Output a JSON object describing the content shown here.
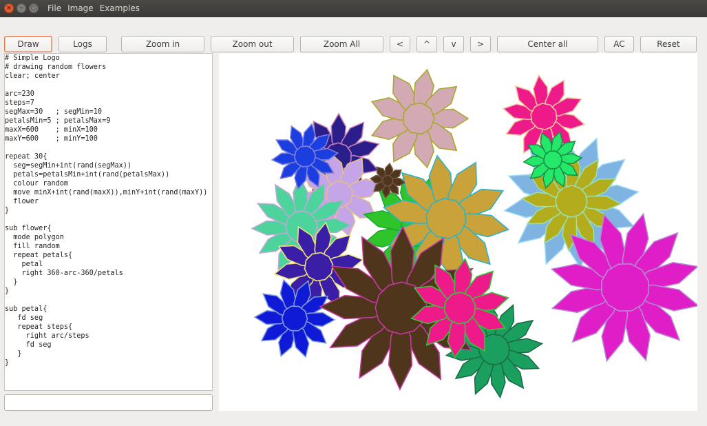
{
  "window": {
    "controls": {
      "close": "×",
      "minimize": "–",
      "maximize": "□"
    }
  },
  "menu": [
    "File",
    "Image",
    "Examples"
  ],
  "toolbar": {
    "draw": "Draw",
    "logs": "Logs",
    "zoom_in": "Zoom in",
    "zoom_out": "Zoom out",
    "zoom_all": "Zoom All",
    "left": "<",
    "up": "^",
    "down": "v",
    "right": ">",
    "center_all": "Center all",
    "ac": "AC",
    "reset": "Reset"
  },
  "editor": {
    "code": "# Simple Logo\n# drawing random flowers\nclear; center\n\narc=230\nsteps=7\nsegMax=30   ; segMin=10\npetalsMin=5 ; petalsMax=9\nmaxX=600    ; minX=100\nmaxY=600    ; minY=100\n\nrepeat 30{\n  seg=segMin+int(rand(segMax))\n  petals=petalsMin+int(rand(petalsMax))\n  colour random\n  move minX+int(rand(maxX)),minY+int(rand(maxY))\n  flower\n}\n\nsub flower{\n  mode polygon\n  fill random\n  repeat petals{\n    petal\n    right 360-arc-360/petals\n  }\n}\n\nsub petal{\n   fd seg\n   repeat steps{\n     right arc/steps\n     fd seg\n   }\n}"
  },
  "command_input": {
    "value": "",
    "placeholder": ""
  },
  "canvas": {
    "flowers": [
      {
        "fill": "#d3a9b4",
        "stroke": "#a9a82e",
        "petals": 9
      },
      {
        "fill": "#ef1a8a",
        "stroke": "#f0c49b",
        "petals": 10
      },
      {
        "fill": "#7fb3e2",
        "stroke": "#9bd8f5",
        "petals": 12
      },
      {
        "fill": "#b3ac1d",
        "stroke": "#99e0ae",
        "petals": 12
      },
      {
        "fill": "#e01ec8",
        "stroke": "#b48ad4",
        "petals": 12
      },
      {
        "fill": "#2a1f8a",
        "stroke": "#c97fb3",
        "petals": 10
      },
      {
        "fill": "#1a3ee0",
        "stroke": "#7f7fd8",
        "petals": 10
      },
      {
        "fill": "#c6a4e8",
        "stroke": "#e0c08a",
        "petals": 8
      },
      {
        "fill": "#4cd49c",
        "stroke": "#c0a6d8",
        "petals": 12
      },
      {
        "fill": "#3a1fa6",
        "stroke": "#f0e07a",
        "petals": 10
      },
      {
        "fill": "#0e1ad6",
        "stroke": "#7f9ad8",
        "petals": 10
      },
      {
        "fill": "#4e351b",
        "stroke": "#c43aa0",
        "petals": 12
      },
      {
        "fill": "#ef1a8a",
        "stroke": "#3ac33a",
        "petals": 10
      },
      {
        "fill": "#1a9f5e",
        "stroke": "#1a6b48",
        "petals": 12
      },
      {
        "fill": "#c9a23a",
        "stroke": "#2ab4c8",
        "petals": 10
      },
      {
        "fill": "#2fc52a",
        "stroke": "#1aa82a",
        "petals": 12
      },
      {
        "fill": "#24e86a",
        "stroke": "#1a8f48",
        "petals": 10
      },
      {
        "fill": "#4e351b",
        "stroke": "#6b5540",
        "petals": 8
      }
    ]
  }
}
